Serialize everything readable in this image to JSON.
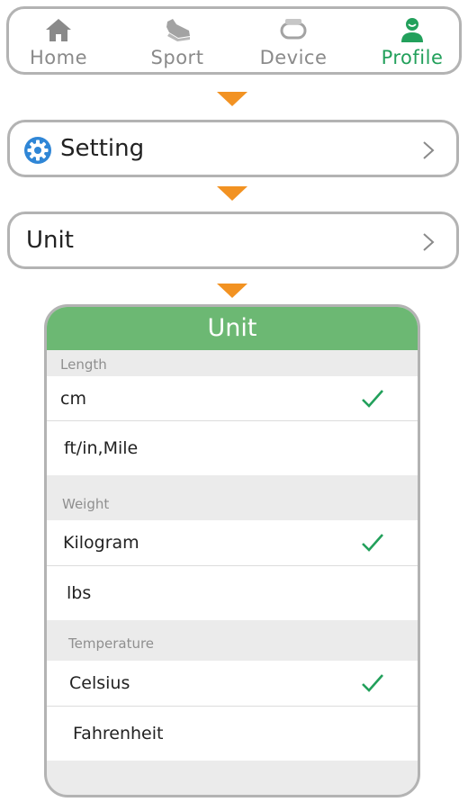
{
  "tabs": [
    {
      "label": "Home",
      "icon": "home-icon",
      "active": false
    },
    {
      "label": "Sport",
      "icon": "sneaker-icon",
      "active": false
    },
    {
      "label": "Device",
      "icon": "band-icon",
      "active": false
    },
    {
      "label": "Profile",
      "icon": "person-icon",
      "active": true
    }
  ],
  "setting_row": {
    "label": "Setting",
    "icon": "gear-icon"
  },
  "unit_row": {
    "label": "Unit"
  },
  "dialog": {
    "title": "Unit",
    "sections": [
      {
        "title": "Length",
        "options": [
          {
            "label": "cm",
            "selected": true
          },
          {
            "label": "ft/in,Mile",
            "selected": false
          }
        ]
      },
      {
        "title": "Weight",
        "options": [
          {
            "label": "Kilogram",
            "selected": true
          },
          {
            "label": "lbs",
            "selected": false
          }
        ]
      },
      {
        "title": "Temperature",
        "options": [
          {
            "label": "Celsius",
            "selected": true
          },
          {
            "label": "Fahrenheit",
            "selected": false
          }
        ]
      }
    ]
  },
  "colors": {
    "accent_green": "#22a05b",
    "header_green": "#6cb873",
    "arrow_orange": "#f29222",
    "inactive_gray": "#8a8a8a",
    "border_gray": "#b3b3b3",
    "gear_blue": "#2f86d6"
  }
}
